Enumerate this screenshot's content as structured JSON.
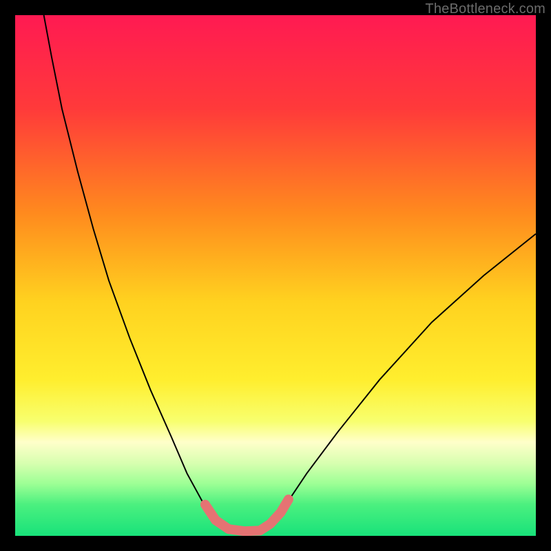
{
  "watermark": "TheBottleneck.com",
  "chart_data": {
    "type": "line",
    "title": "",
    "xlabel": "",
    "ylabel": "",
    "xlim": [
      0,
      100
    ],
    "ylim": [
      0,
      100
    ],
    "background_gradient": {
      "stops": [
        {
          "offset": 0,
          "color": "#ff1a52"
        },
        {
          "offset": 18,
          "color": "#ff3a3a"
        },
        {
          "offset": 38,
          "color": "#ff8a1e"
        },
        {
          "offset": 55,
          "color": "#ffd21f"
        },
        {
          "offset": 70,
          "color": "#ffee2e"
        },
        {
          "offset": 78,
          "color": "#f8ff6e"
        },
        {
          "offset": 82,
          "color": "#ffffca"
        },
        {
          "offset": 86,
          "color": "#d8ffb0"
        },
        {
          "offset": 90,
          "color": "#9dff95"
        },
        {
          "offset": 94,
          "color": "#4bf07f"
        },
        {
          "offset": 100,
          "color": "#18e27a"
        }
      ]
    },
    "series": [
      {
        "name": "bottleneck-curve",
        "stroke": "#000000",
        "stroke_width": 2,
        "points": [
          {
            "x": 5.5,
            "y": 100.0
          },
          {
            "x": 7.0,
            "y": 92.0
          },
          {
            "x": 9.0,
            "y": 82.0
          },
          {
            "x": 12.0,
            "y": 70.0
          },
          {
            "x": 15.0,
            "y": 59.0
          },
          {
            "x": 18.0,
            "y": 49.0
          },
          {
            "x": 22.0,
            "y": 38.0
          },
          {
            "x": 26.0,
            "y": 28.0
          },
          {
            "x": 30.0,
            "y": 19.0
          },
          {
            "x": 33.0,
            "y": 12.0
          },
          {
            "x": 36.0,
            "y": 6.5
          },
          {
            "x": 38.5,
            "y": 3.0
          },
          {
            "x": 41.0,
            "y": 1.3
          },
          {
            "x": 44.0,
            "y": 0.8
          },
          {
            "x": 47.0,
            "y": 1.0
          },
          {
            "x": 49.5,
            "y": 2.5
          },
          {
            "x": 52.0,
            "y": 6.0
          },
          {
            "x": 56.0,
            "y": 12.0
          },
          {
            "x": 62.0,
            "y": 20.0
          },
          {
            "x": 70.0,
            "y": 30.0
          },
          {
            "x": 80.0,
            "y": 41.0
          },
          {
            "x": 90.0,
            "y": 50.0
          },
          {
            "x": 100.0,
            "y": 58.0
          }
        ]
      },
      {
        "name": "highlight-segment",
        "stroke": "#e57373",
        "stroke_width": 14,
        "linecap": "round",
        "points": [
          {
            "x": 36.5,
            "y": 6.0
          },
          {
            "x": 38.5,
            "y": 3.0
          },
          {
            "x": 41.0,
            "y": 1.3
          },
          {
            "x": 44.0,
            "y": 0.9
          },
          {
            "x": 47.0,
            "y": 1.0
          },
          {
            "x": 49.0,
            "y": 2.3
          },
          {
            "x": 51.0,
            "y": 4.5
          },
          {
            "x": 52.5,
            "y": 7.0
          }
        ]
      }
    ]
  }
}
